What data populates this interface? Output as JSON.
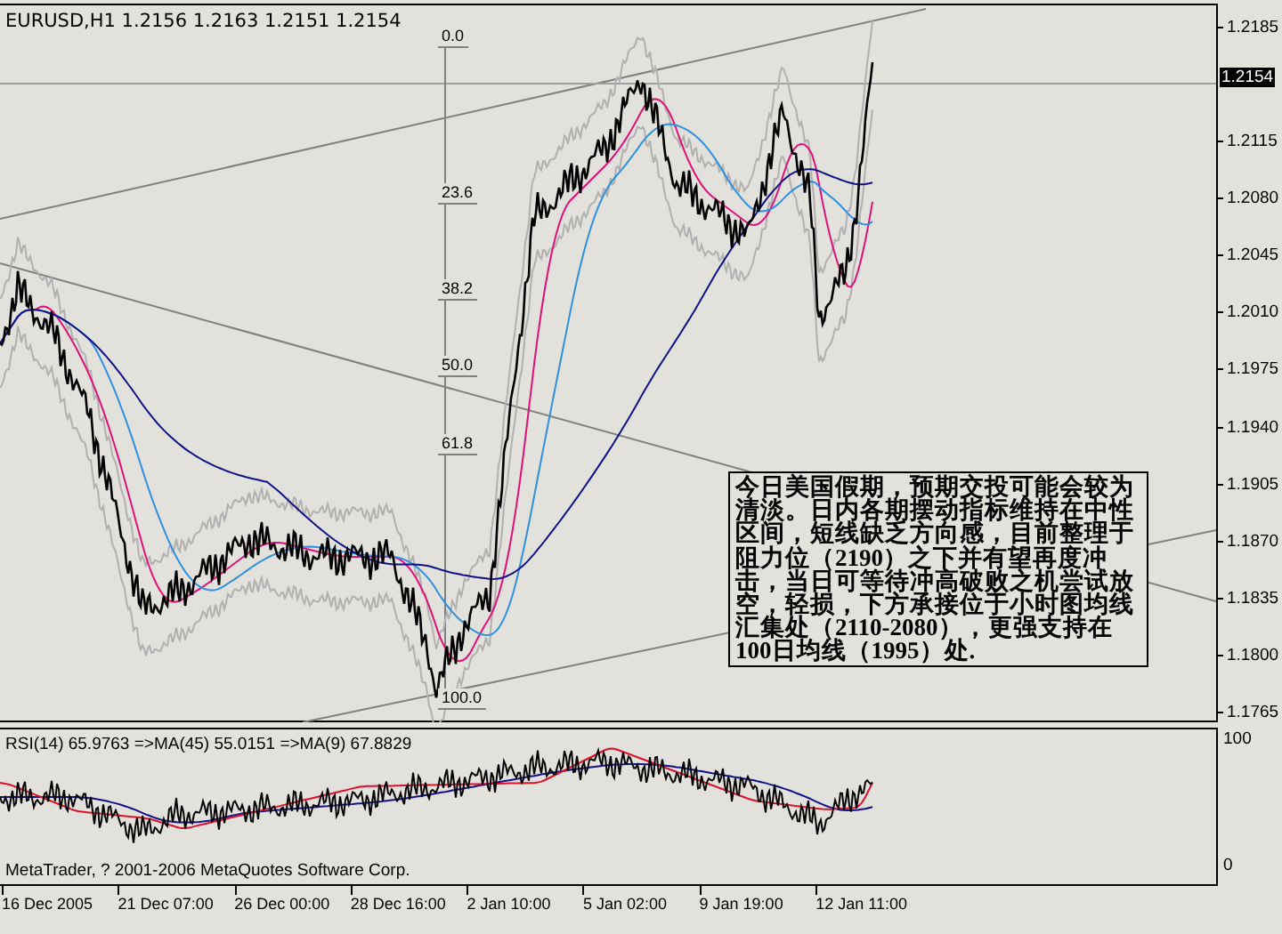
{
  "chart": {
    "header": "EURUSD,H1  1.2156 1.2163 1.2151 1.2154",
    "price_axis": [
      "1.2185",
      "1.2115",
      "1.2080",
      "1.2045",
      "1.2010",
      "1.1975",
      "1.1940",
      "1.1905",
      "1.1870",
      "1.1835",
      "1.1800",
      "1.1765"
    ],
    "current_price": "1.2154",
    "fibonacci_levels": [
      "0.0",
      "23.6",
      "38.2",
      "50.0",
      "61.8",
      "100.0"
    ],
    "note": "今日美国假期，预期交投可能会较为清淡。日内各期摆动指标维持在中性区间，短线缺乏方向感，目前整理于阻力位（2190）之下并有望再度冲击，当日可等待冲高破败之机尝试放空，轻损，下方承接位于小时图均线汇集处（2110-2080），更强支持在100日均线（1995）处."
  },
  "rsi_panel": {
    "header": "RSI(14) 65.9763  =>MA(45) 55.0151  =>MA(9) 67.8829",
    "axis": [
      "100",
      "0"
    ],
    "copyright": "MetaTrader, ? 2001-2006 MetaQuotes Software Corp."
  },
  "time_axis": [
    "16 Dec 2005",
    "21 Dec 07:00",
    "26 Dec 00:00",
    "28 Dec 16:00",
    "2 Jan 10:00",
    "5 Jan 02:00",
    "9 Jan 19:00",
    "12 Jan 11:00"
  ]
}
